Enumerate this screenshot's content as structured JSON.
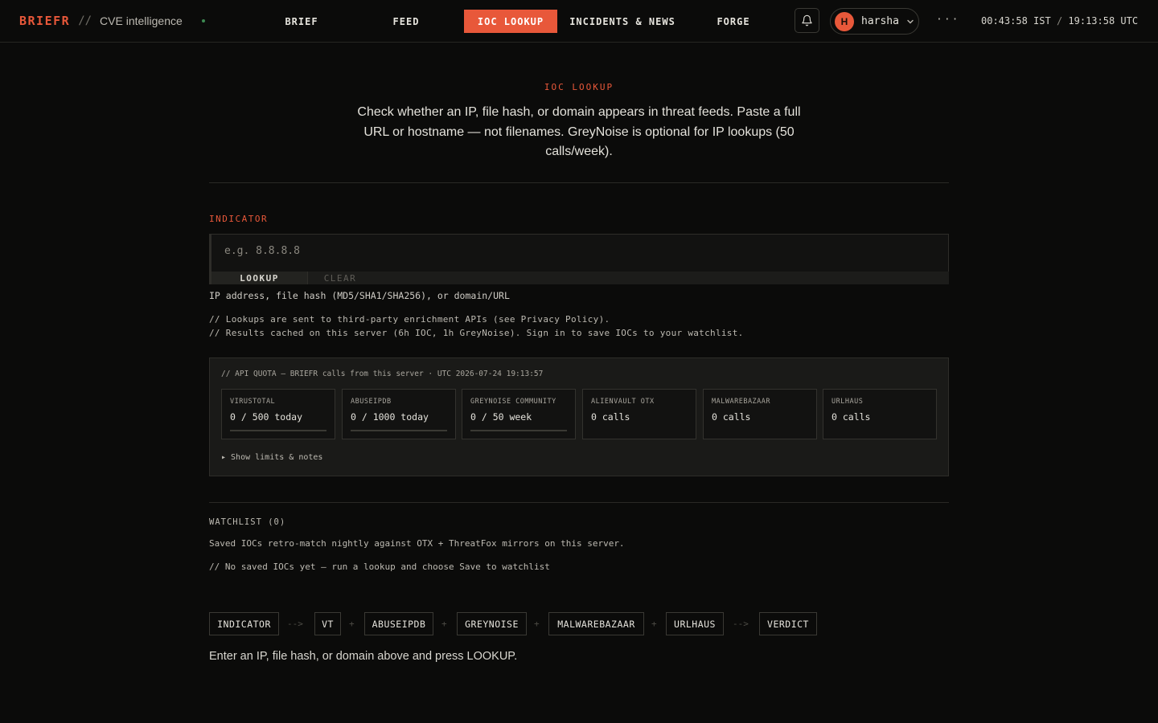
{
  "brand": {
    "name": "BRIEFR",
    "separator": "//",
    "subtitle": "CVE intelligence"
  },
  "nav": [
    {
      "label": "BRIEF",
      "active": false
    },
    {
      "label": "FEED",
      "active": false
    },
    {
      "label": "IOC LOOKUP",
      "active": true
    },
    {
      "label": "INCIDENTS & NEWS",
      "active": false
    },
    {
      "label": "FORGE",
      "active": false
    }
  ],
  "header": {
    "notifications_icon": "bell-icon",
    "user": {
      "initial": "H",
      "name": "harsha"
    },
    "more_label": "···",
    "clock": {
      "ist": "00:43:58 IST",
      "sep": "/",
      "utc": "19:13:58 UTC"
    }
  },
  "hero": {
    "eyebrow": "IOC LOOKUP",
    "description": "Check whether an IP, file hash, or domain appears in threat feeds. Paste a full URL or hostname — not filenames. GreyNoise is optional for IP lookups (50 calls/week)."
  },
  "indicator": {
    "label": "INDICATOR",
    "placeholder": "e.g. 8.8.8.8",
    "value": "",
    "lookup_label": "LOOKUP",
    "clear_label": "CLEAR",
    "help": "IP address, file hash (MD5/SHA1/SHA256), or domain/URL",
    "notes": [
      "// Lookups are sent to third-party enrichment APIs (see Privacy Policy).",
      "// Results cached on this server (6h IOC, 1h GreyNoise). Sign in to save IOCs to your watchlist."
    ]
  },
  "quota": {
    "header": "// API QUOTA — BRIEFR calls from this server · UTC 2026-07-24 19:13:57",
    "cards": [
      {
        "name": "VIRUSTOTAL",
        "value": "0 / 500 today",
        "usage": 0,
        "has_bar": true
      },
      {
        "name": "ABUSEIPDB",
        "value": "0 / 1000 today",
        "usage": 0,
        "has_bar": true
      },
      {
        "name": "GREYNOISE COMMUNITY",
        "value": "0 / 50 week",
        "usage": 0,
        "has_bar": true
      },
      {
        "name": "ALIENVAULT OTX",
        "value": "0 calls",
        "has_bar": false
      },
      {
        "name": "MALWAREBAZAAR",
        "value": "0 calls",
        "has_bar": false
      },
      {
        "name": "URLHAUS",
        "value": "0 calls",
        "has_bar": false
      }
    ],
    "show_limits": "▸ Show limits & notes"
  },
  "watchlist": {
    "title": "WATCHLIST (0)",
    "description": "Saved IOCs retro-match nightly against OTX + ThreatFox mirrors on this server.",
    "empty": "// No saved IOCs yet — run a lookup and choose Save to watchlist"
  },
  "pipeline": {
    "nodes": [
      "INDICATOR",
      "VT",
      "ABUSEIPDB",
      "GREYNOISE",
      "MALWAREBAZAAR",
      "URLHAUS",
      "VERDICT"
    ],
    "connectors": [
      "-->",
      "+",
      "+",
      "+",
      "+",
      "-->"
    ]
  },
  "footer_hint": "Enter an IP, file hash, or domain above and press LOOKUP.",
  "colors": {
    "accent": "#e8583a",
    "background": "#0b0b0a",
    "panel": "#1a1a18",
    "status_ok": "#3d8a52"
  }
}
